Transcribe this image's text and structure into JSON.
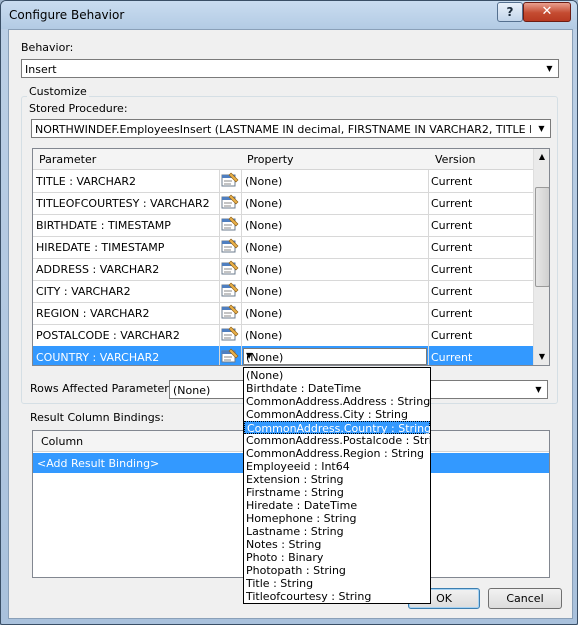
{
  "window": {
    "title": "Configure Behavior",
    "help_label": "?",
    "close_label": "✕"
  },
  "behavior": {
    "label": "Behavior:",
    "value": "Insert"
  },
  "customize": {
    "label": "Customize",
    "sp_label": "Stored Procedure:",
    "sp_value": "NORTHWINDEF.EmployeesInsert (LASTNAME IN decimal, FIRSTNAME IN VARCHAR2, TITLE IN VARCHA"
  },
  "grid": {
    "headers": {
      "parameter": "Parameter",
      "property": "Property",
      "version": "Version"
    },
    "rows": [
      {
        "parameter": "TITLE : VARCHAR2",
        "property": "(None)",
        "version": "Current"
      },
      {
        "parameter": "TITLEOFCOURTESY : VARCHAR2",
        "property": "(None)",
        "version": "Current"
      },
      {
        "parameter": "BIRTHDATE : TIMESTAMP",
        "property": "(None)",
        "version": "Current"
      },
      {
        "parameter": "HIREDATE : TIMESTAMP",
        "property": "(None)",
        "version": "Current"
      },
      {
        "parameter": "ADDRESS : VARCHAR2",
        "property": "(None)",
        "version": "Current"
      },
      {
        "parameter": "CITY : VARCHAR2",
        "property": "(None)",
        "version": "Current"
      },
      {
        "parameter": "REGION : VARCHAR2",
        "property": "(None)",
        "version": "Current"
      },
      {
        "parameter": "POSTALCODE : VARCHAR2",
        "property": "(None)",
        "version": "Current"
      },
      {
        "parameter": "COUNTRY : VARCHAR2",
        "property": "(None)",
        "version": "Current"
      }
    ]
  },
  "rows_affected": {
    "label": "Rows Affected Parameter:",
    "value": "(None)"
  },
  "result_bindings": {
    "label": "Result Column Bindings:",
    "column_header": "Column",
    "add_row": "<Add Result Binding>"
  },
  "buttons": {
    "ok": "OK",
    "cancel": "Cancel"
  },
  "dropdown": {
    "highlighted_index": 4,
    "options": [
      "(None)",
      "Birthdate : DateTime",
      "CommonAddress.Address : String",
      "CommonAddress.City : String",
      "CommonAddress.Country : String",
      "CommonAddress.Postalcode : String",
      "CommonAddress.Region : String",
      "Employeeid : Int64",
      "Extension : String",
      "Firstname : String",
      "Hiredate : DateTime",
      "Homephone : String",
      "Lastname : String",
      "Notes : String",
      "Photo : Binary",
      "Photopath : String",
      "Title : String",
      "Titleofcourtesy : String"
    ]
  },
  "colors": {
    "selection": "#3399ff",
    "window_frame": "#b3cbe4",
    "close": "#c44b31"
  }
}
